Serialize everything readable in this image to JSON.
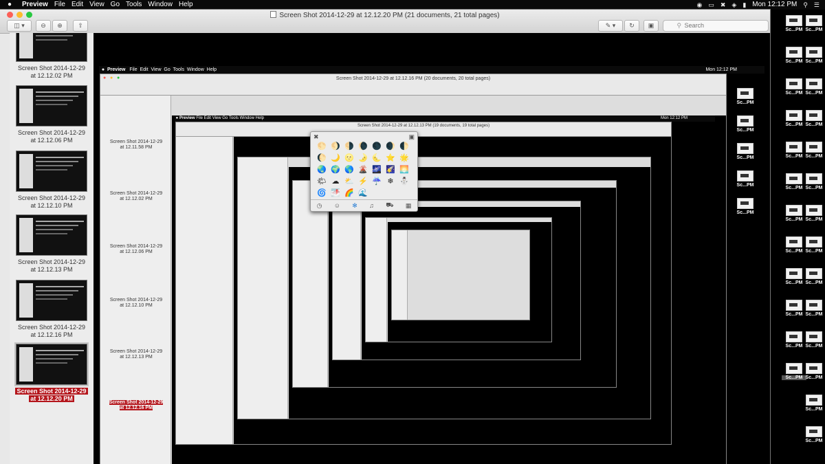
{
  "menubar": {
    "apple": "",
    "app_name": "Preview",
    "items": [
      "File",
      "Edit",
      "View",
      "Go",
      "Tools",
      "Window",
      "Help"
    ],
    "clock": "Mon 12:12 PM"
  },
  "window": {
    "title": "Screen Shot 2014-12-29 at 12.12.20 PM (21 documents, 21 total pages)",
    "search_placeholder": "Search"
  },
  "sidebar": {
    "items": [
      {
        "line1": "Screen Shot 2014-12-29",
        "line2": "at 12.12.02 PM"
      },
      {
        "line1": "Screen Shot 2014-12-29",
        "line2": "at 12.12.06 PM"
      },
      {
        "line1": "Screen Shot 2014-12-29",
        "line2": "at 12.12.10 PM"
      },
      {
        "line1": "Screen Shot 2014-12-29",
        "line2": "at 12.12.13 PM"
      },
      {
        "line1": "Screen Shot 2014-12-29",
        "line2": "at 12.12.16 PM"
      },
      {
        "line1": "Screen Shot 2014-12-29",
        "line2": "at 12.12.20 PM",
        "selected": true
      }
    ]
  },
  "nested": {
    "level1_title": "Screen Shot 2014-12-29 at 12.12.16 PM (20 documents, 20 total pages)",
    "level1_clock": "Mon 12:12 PM",
    "level1_thumbs": [
      {
        "line1": "Screen Shot 2014-12-29",
        "line2": "at 12.11.58 PM"
      },
      {
        "line1": "Screen Shot 2014-12-29",
        "line2": "at 12.12.02 PM"
      },
      {
        "line1": "Screen Shot 2014-12-29",
        "line2": "at 12.12.06 PM"
      },
      {
        "line1": "Screen Shot 2014-12-29",
        "line2": "at 12.12.10 PM"
      },
      {
        "line1": "Screen Shot 2014-12-29",
        "line2": "at 12.12.13 PM"
      },
      {
        "line1": "Screen Shot 2014-12-29",
        "line2": "at 12.12.16 PM"
      }
    ],
    "level2_title": "Screen Shot 2014-12-29 at 12.12.13 PM (19 documents, 19 total pages)",
    "level2_clock": "Mon 12:12 PM"
  },
  "emoji_palette": {
    "glyphs": [
      "🌕",
      "🌖",
      "🌗",
      "🌘",
      "🌑",
      "🌒",
      "🌓",
      "🌔",
      "🌙",
      "🌝",
      "🌛",
      "🌜",
      "⭐",
      "🌟",
      "🌏",
      "🌍",
      "🌎",
      "🌋",
      "🌌",
      "🌠",
      "🌅",
      "🌤",
      "☁",
      "⛅",
      "⚡",
      "☔",
      "❄",
      "⛄",
      "🌀",
      "🌁",
      "🌈",
      "🌊"
    ],
    "tabs": [
      "recent-icon",
      "smiley-icon",
      "nature-icon",
      "bell-icon",
      "car-icon",
      "symbols-icon"
    ]
  },
  "desktop": {
    "label": "Sc...PM"
  },
  "colors": {
    "selection_red": "#b4151b",
    "menubar": "#0a0a0a",
    "window_bg": "#e8e8e8"
  }
}
